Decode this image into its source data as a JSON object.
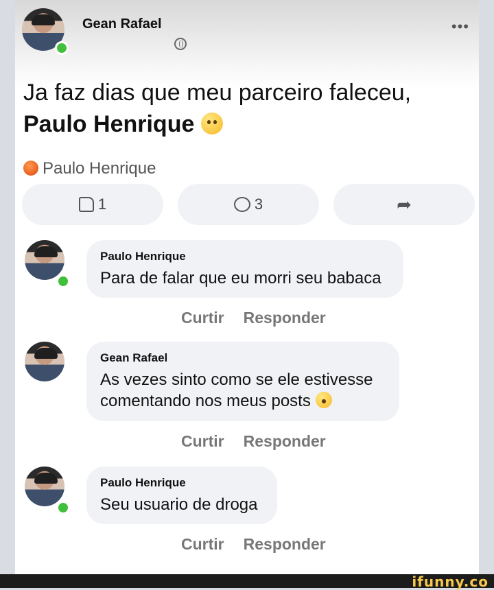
{
  "post": {
    "author": "Gean Rafael",
    "more_label": "•••",
    "text": "Ja faz dias que meu parceiro faleceu,",
    "tagged_name": "Paulo Henrique",
    "tag_line": "Paulo Henrique",
    "likes_count": "1",
    "comments_count": "3"
  },
  "comments": [
    {
      "name": "Paulo Henrique",
      "text": "Para de falar que eu morri seu babaca",
      "like_label": "Curtir",
      "reply_label": "Responder"
    },
    {
      "name": "Gean Rafael",
      "text_line1": "As vezes sinto como se ele estivesse",
      "text_line2": "comentando nos meus posts",
      "like_label": "Curtir",
      "reply_label": "Responder"
    },
    {
      "name": "Paulo Henrique",
      "text": "Seu usuario de droga",
      "like_label": "Curtir",
      "reply_label": "Responder"
    }
  ],
  "watermark": "ifunny.co"
}
